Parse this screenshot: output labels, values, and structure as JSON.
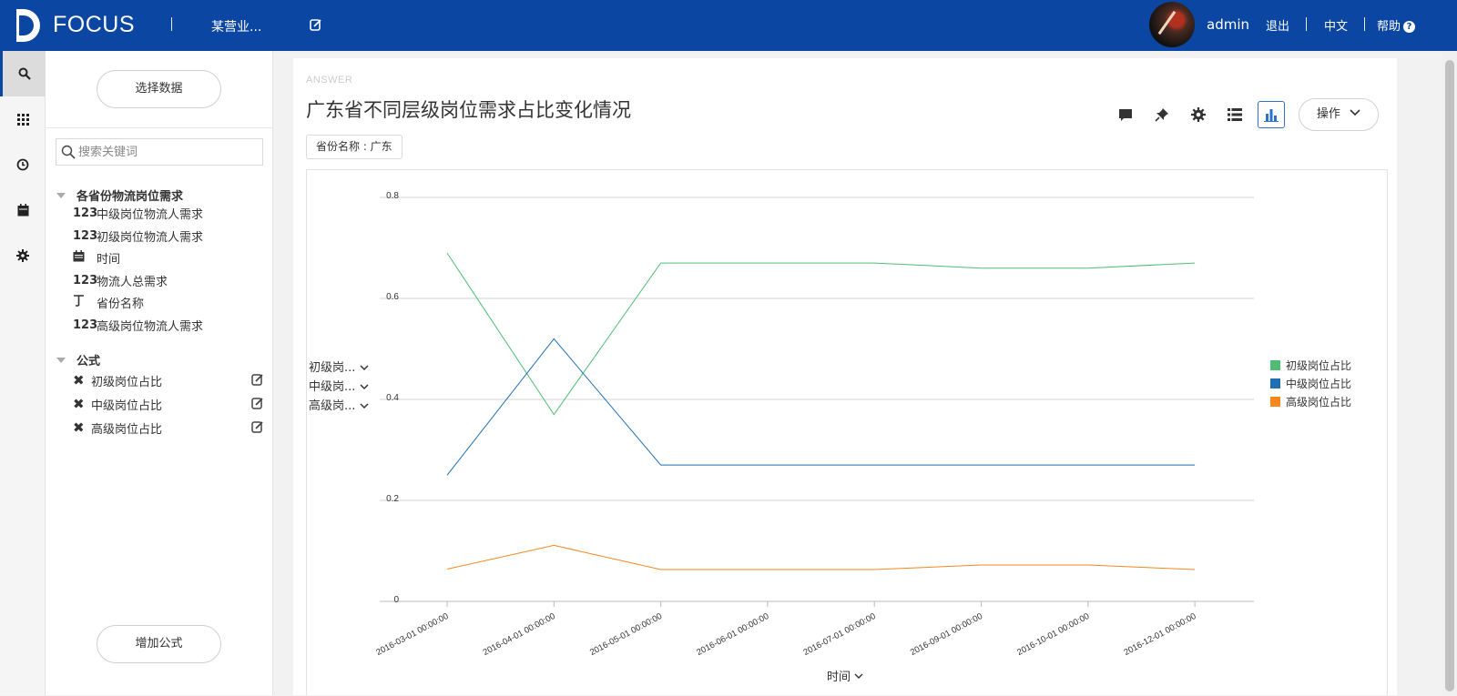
{
  "header": {
    "brand": "FOCUS",
    "page_name": "某营业...",
    "username": "admin",
    "logout": "退出",
    "language": "中文",
    "help": "帮助"
  },
  "panel": {
    "select_data_btn": "选择数据",
    "search_placeholder": "搜索关键词",
    "table_group": "各省份物流岗位需求",
    "fields": [
      {
        "type": "123",
        "label": "中级岗位物流人需求"
      },
      {
        "type": "123",
        "label": "初级岗位物流人需求"
      },
      {
        "type": "calendar",
        "label": "时间"
      },
      {
        "type": "123",
        "label": "物流人总需求"
      },
      {
        "type": "text",
        "label": "省份名称"
      },
      {
        "type": "123",
        "label": "高级岗位物流人需求"
      }
    ],
    "formula_group": "公式",
    "formulas": [
      "初级岗位占比",
      "中级岗位占比",
      "高级岗位占比"
    ],
    "add_formula_btn": "增加公式"
  },
  "answer": {
    "label": "ANSWER",
    "title": "广东省不同层级岗位需求占比变化情况",
    "filter": "省份名称 : 广东",
    "ops_btn": "操作",
    "measure_selectors": [
      "初级岗...",
      "中级岗...",
      "高级岗..."
    ]
  },
  "colors": {
    "header_bg": "#0b46a2",
    "series": [
      "#4dbd74",
      "#1f6fb5",
      "#f7861c"
    ]
  },
  "chart_data": {
    "type": "line",
    "x": [
      "2016-03-01 00:00:00",
      "2016-04-01 00:00:00",
      "2016-05-01 00:00:00",
      "2016-06-01 00:00:00",
      "2016-07-01 00:00:00",
      "2016-09-01 00:00:00",
      "2016-10-01 00:00:00",
      "2016-12-01 00:00:00"
    ],
    "series": [
      {
        "name": "初级岗位占比",
        "values": [
          0.69,
          0.37,
          0.67,
          0.67,
          0.67,
          0.66,
          0.66,
          0.67
        ]
      },
      {
        "name": "中级岗位占比",
        "values": [
          0.25,
          0.52,
          0.27,
          0.27,
          0.27,
          0.27,
          0.27,
          0.27
        ]
      },
      {
        "name": "高级岗位占比",
        "values": [
          0.064,
          0.111,
          0.063,
          0.063,
          0.063,
          0.072,
          0.072,
          0.063
        ]
      }
    ],
    "ylim": [
      0,
      0.8
    ],
    "yticks": [
      "0",
      "0.2",
      "0.4",
      "0.6",
      "0.8"
    ],
    "xlabel": "时间",
    "ylabel": "",
    "grid": true,
    "legend": "right"
  }
}
